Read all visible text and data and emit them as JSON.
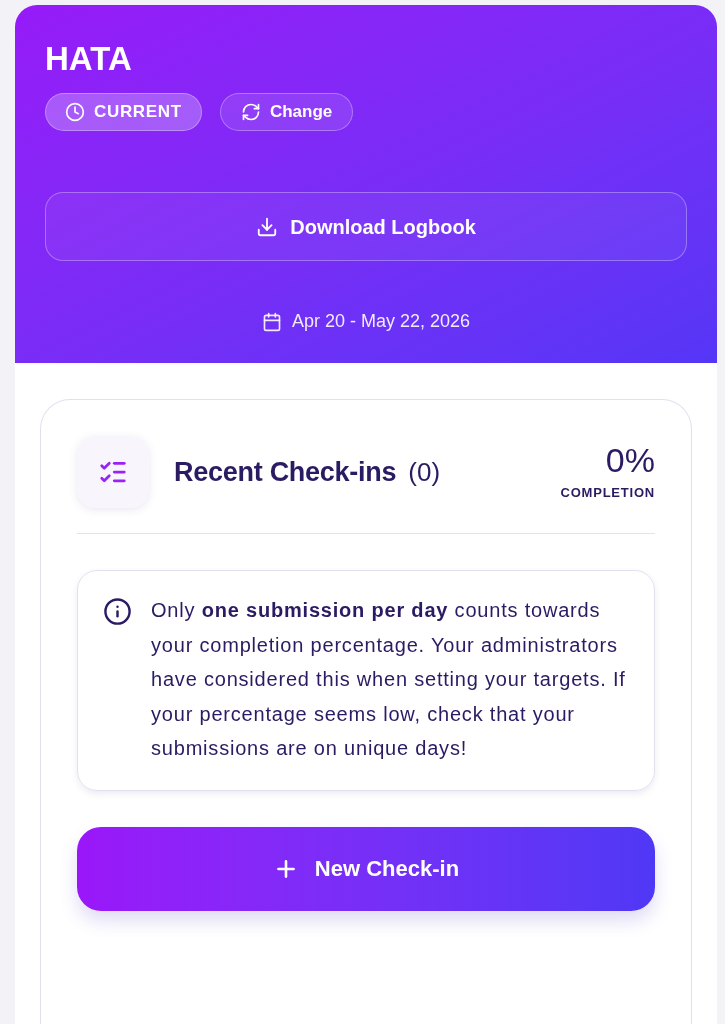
{
  "header": {
    "title": "HATA",
    "badges": [
      {
        "kind": "status",
        "label": "CURRENT"
      },
      {
        "kind": "action",
        "label": "Change"
      }
    ],
    "download_button": {
      "label": "Download Logbook"
    },
    "date_range": "Apr 20 - May 22, 2026"
  },
  "checkins_card": {
    "title": "Recent Check-ins",
    "count": "(0)",
    "completion": {
      "value": "0%",
      "label": "COMPLETION"
    },
    "notice": "Only **one submission per day** counts towards your completion percentage. Your administrators have considered this when setting your targets. If your percentage seems low, check that your submissions are on unique days!",
    "new_button": {
      "label": "New Check-in"
    }
  }
}
